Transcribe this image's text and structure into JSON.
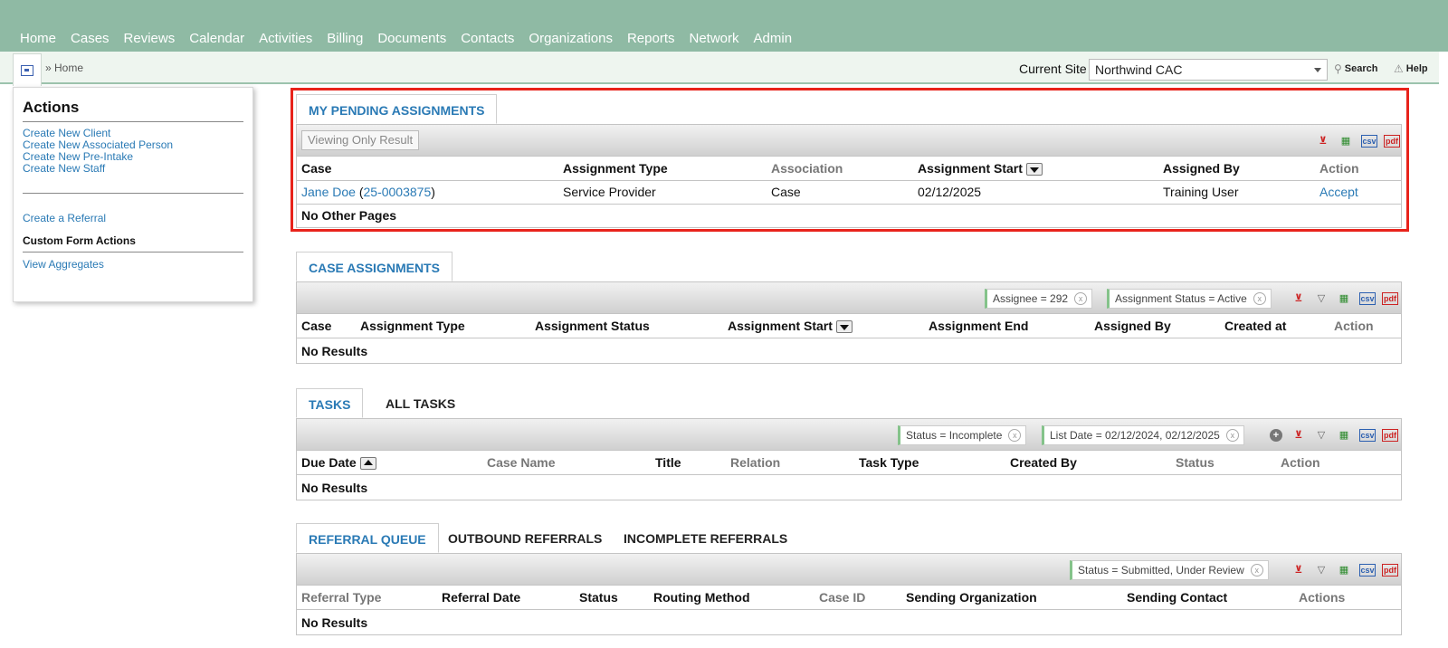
{
  "nav": [
    "Home",
    "Cases",
    "Reviews",
    "Calendar",
    "Activities",
    "Billing",
    "Documents",
    "Contacts",
    "Organizations",
    "Reports",
    "Network",
    "Admin"
  ],
  "breadcrumb": "» Home",
  "site": {
    "label": "Current Site",
    "value": "Northwind CAC"
  },
  "tools": {
    "search": "Search",
    "help": "Help"
  },
  "actions": {
    "title": "Actions",
    "create_links": [
      "Create New Client",
      "Create New Associated Person",
      "Create New Pre-Intake",
      "Create New Staff"
    ],
    "referral_link": "Create a Referral",
    "custom_form": "Custom Form Actions",
    "aggregates": "View Aggregates"
  },
  "pending": {
    "tab": "MY PENDING ASSIGNMENTS",
    "viewing_btn": "Viewing Only Result",
    "columns": [
      "Case",
      "Assignment Type",
      "Association",
      "Assignment Start",
      "Assigned By",
      "Action"
    ],
    "row": {
      "case_name": "Jane Doe",
      "case_open": " (",
      "case_id": "25-0003875",
      "case_close": ")",
      "type": "Service Provider",
      "association": "Case",
      "start": "02/12/2025",
      "assigned_by": "Training User",
      "action": "Accept"
    },
    "footer": "No Other Pages"
  },
  "case_assignments": {
    "tab": "CASE ASSIGNMENTS",
    "filters": [
      "Assignee = 292",
      "Assignment Status = Active"
    ],
    "columns": [
      "Case",
      "Assignment Type",
      "Assignment Status",
      "Assignment Start",
      "Assignment End",
      "Assigned By",
      "Created at",
      "Action"
    ],
    "empty": "No Results"
  },
  "tasks": {
    "tabs": [
      "TASKS",
      "ALL TASKS"
    ],
    "filters": [
      "Status = Incomplete",
      "List Date = 02/12/2024, 02/12/2025"
    ],
    "columns": [
      "Due Date",
      "Case Name",
      "Title",
      "Relation",
      "Task Type",
      "Created By",
      "Status",
      "Action"
    ],
    "empty": "No Results"
  },
  "referrals": {
    "tabs": [
      "REFERRAL QUEUE",
      "OUTBOUND REFERRALS",
      "INCOMPLETE REFERRALS"
    ],
    "filters": [
      "Status = Submitted, Under Review"
    ],
    "columns": [
      "Referral Type",
      "Referral Date",
      "Status",
      "Routing Method",
      "Case ID",
      "Sending Organization",
      "Sending Contact",
      "Actions"
    ],
    "empty": "No Results"
  },
  "icons": {
    "clear": "clear-filter-icon",
    "filter": "filter-icon",
    "export": "export-icon",
    "csv": "csv-icon",
    "pdf": "pdf-icon",
    "add": "add-filter-icon"
  },
  "colors": {
    "nav_bg": "#8fbaa4",
    "link": "#2a7ab5",
    "highlight": "#e8231b",
    "chip_accent": "#84c38a"
  }
}
